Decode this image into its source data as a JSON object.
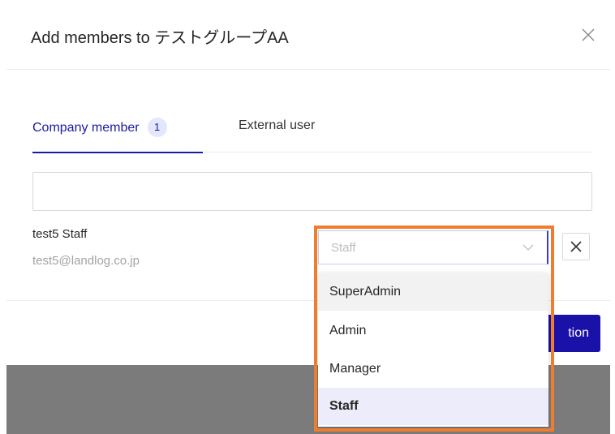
{
  "modal": {
    "title": "Add members to テストグループAA"
  },
  "tabs": [
    {
      "label": "Company member",
      "badge": "1"
    },
    {
      "label": "External user"
    }
  ],
  "search": {
    "value": "",
    "placeholder": ""
  },
  "member": {
    "name": "test5 Staff",
    "email": "test5@landlog.co.jp",
    "role": "Staff"
  },
  "role_options": [
    "SuperAdmin",
    "Admin",
    "Manager",
    "Staff"
  ],
  "submit_button": {
    "visible_label": "tion"
  },
  "colors": {
    "accent": "#1a11a8",
    "highlight": "#ee7d2f",
    "selected_bg": "#ececfb",
    "hover_bg": "#f2f2f2"
  },
  "icons": {
    "close": "close-icon",
    "chevron": "chevron-down-icon",
    "remove": "remove-icon"
  }
}
